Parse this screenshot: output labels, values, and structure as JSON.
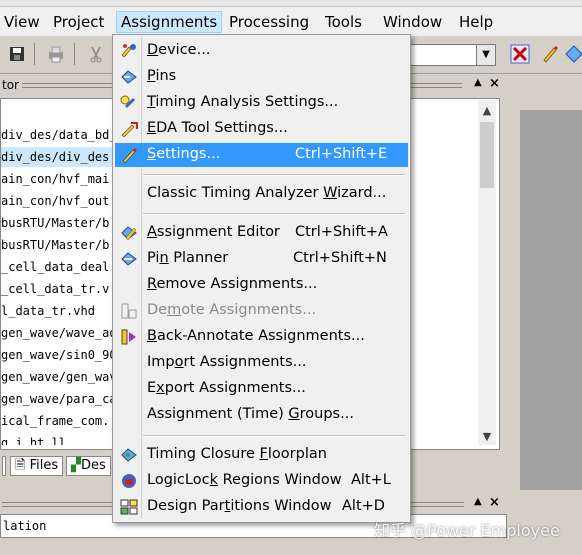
{
  "menubar": {
    "items": [
      "View",
      "Project",
      "Assignments",
      "Processing",
      "Tools",
      "Window",
      "Help"
    ],
    "active": "Assignments"
  },
  "panel": {
    "title": "tor",
    "files": [
      "div_des/data_bd_",
      "div_des/div_des.",
      "ain_con/hvf_mai",
      "ain_con/hvf_out",
      "busRTU/Master/b",
      "busRTU/Master/b",
      "_cell_data_deal",
      "_cell_data_tr.v",
      "l_data_tr.vhd",
      "gen_wave/wave_ad",
      "gen_wave/sin0_90",
      "gen_wave/gen_wav",
      "gen_wave/para_ca",
      "ical_frame_com.",
      "g        i ht  ll"
    ],
    "tabs": [
      "Files",
      "Des"
    ]
  },
  "bottom": {
    "text": "lation"
  },
  "menu": {
    "items": [
      {
        "name": "device",
        "label": "Device...",
        "shortcut": "",
        "icon": "device-icon",
        "disabled": false
      },
      {
        "name": "pins",
        "label": "Pins",
        "shortcut": "",
        "icon": "pins-icon",
        "disabled": false
      },
      {
        "name": "timing-analysis-settings",
        "label": "Timing Analysis Settings...",
        "shortcut": "",
        "icon": "timing-icon",
        "disabled": false
      },
      {
        "name": "eda-tool-settings",
        "label": "EDA Tool Settings...",
        "shortcut": "",
        "icon": "eda-icon",
        "disabled": false
      },
      {
        "name": "settings",
        "label": "Settings...",
        "shortcut": "Ctrl+Shift+E",
        "icon": "pencil-icon",
        "disabled": false,
        "highlighted": true
      },
      {
        "name": "classic-timing-wizard",
        "label": "Classic Timing Analyzer Wizard...",
        "shortcut": "",
        "icon": "",
        "disabled": false
      },
      {
        "name": "assignment-editor",
        "label": "Assignment Editor",
        "shortcut": "Ctrl+Shift+A",
        "icon": "assignment-editor-icon",
        "disabled": false
      },
      {
        "name": "pin-planner",
        "label": "Pin Planner",
        "shortcut": "Ctrl+Shift+N",
        "icon": "pin-planner-icon",
        "disabled": false
      },
      {
        "name": "remove-assignments",
        "label": "Remove Assignments...",
        "shortcut": "",
        "icon": "",
        "disabled": false
      },
      {
        "name": "demote-assignments",
        "label": "Demote Assignments...",
        "shortcut": "",
        "icon": "demote-icon",
        "disabled": true
      },
      {
        "name": "back-annotate",
        "label": "Back-Annotate Assignments...",
        "shortcut": "",
        "icon": "back-annotate-icon",
        "disabled": false
      },
      {
        "name": "import-assignments",
        "label": "Import Assignments...",
        "shortcut": "",
        "icon": "",
        "disabled": false
      },
      {
        "name": "export-assignments",
        "label": "Export Assignments...",
        "shortcut": "",
        "icon": "",
        "disabled": false
      },
      {
        "name": "assignment-time-groups",
        "label": "Assignment (Time) Groups...",
        "shortcut": "",
        "icon": "",
        "disabled": false
      },
      {
        "name": "timing-closure-floorplan",
        "label": "Timing Closure Floorplan",
        "shortcut": "",
        "icon": "floorplan-icon",
        "disabled": false
      },
      {
        "name": "logiclock-regions",
        "label": "LogicLock Regions Window",
        "shortcut": "Alt+L",
        "icon": "logiclock-icon",
        "disabled": false
      },
      {
        "name": "design-partitions",
        "label": "Design Partitions Window",
        "shortcut": "Alt+D",
        "icon": "partitions-icon",
        "disabled": false
      }
    ]
  },
  "watermark": "知乎 @Power Employee",
  "colors": {
    "highlight": "#3399ff",
    "menubar_active": "#cce8ff"
  }
}
